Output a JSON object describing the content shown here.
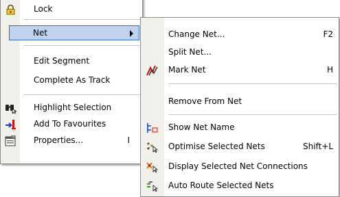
{
  "left_menu": {
    "items": [
      {
        "label": "Lock",
        "icon": "lock-icon"
      },
      {
        "label": "Net",
        "submenu": true
      },
      {
        "label": "Edit Segment"
      },
      {
        "label": "Complete As Track"
      },
      {
        "label": "Highlight Selection",
        "icon": "binoculars-icon"
      },
      {
        "label": "Add To Favourites",
        "icon": "add-favourite-icon"
      },
      {
        "label": "Properties...",
        "shortcut": "I",
        "icon": "properties-icon"
      }
    ]
  },
  "right_menu": {
    "items": [
      {
        "label": "Change Net...",
        "shortcut": "F2"
      },
      {
        "label": "Split Net..."
      },
      {
        "label": "Mark Net",
        "shortcut": "H",
        "icon": "mark-net-icon"
      },
      {
        "label": "Remove From Net"
      },
      {
        "label": "Show Net Name",
        "icon": "show-net-name-icon"
      },
      {
        "label": "Optimise Selected Nets",
        "shortcut": "Shift+L",
        "icon": "optimise-nets-icon"
      },
      {
        "label": "Display Selected Net Connections",
        "icon": "display-connections-icon"
      },
      {
        "label": "Auto Route Selected Nets",
        "icon": "auto-route-icon"
      }
    ]
  },
  "colors": {
    "selection_fill": "#c1d2ee",
    "selection_border": "#316ac5",
    "gutter": "#f2f0ea"
  }
}
